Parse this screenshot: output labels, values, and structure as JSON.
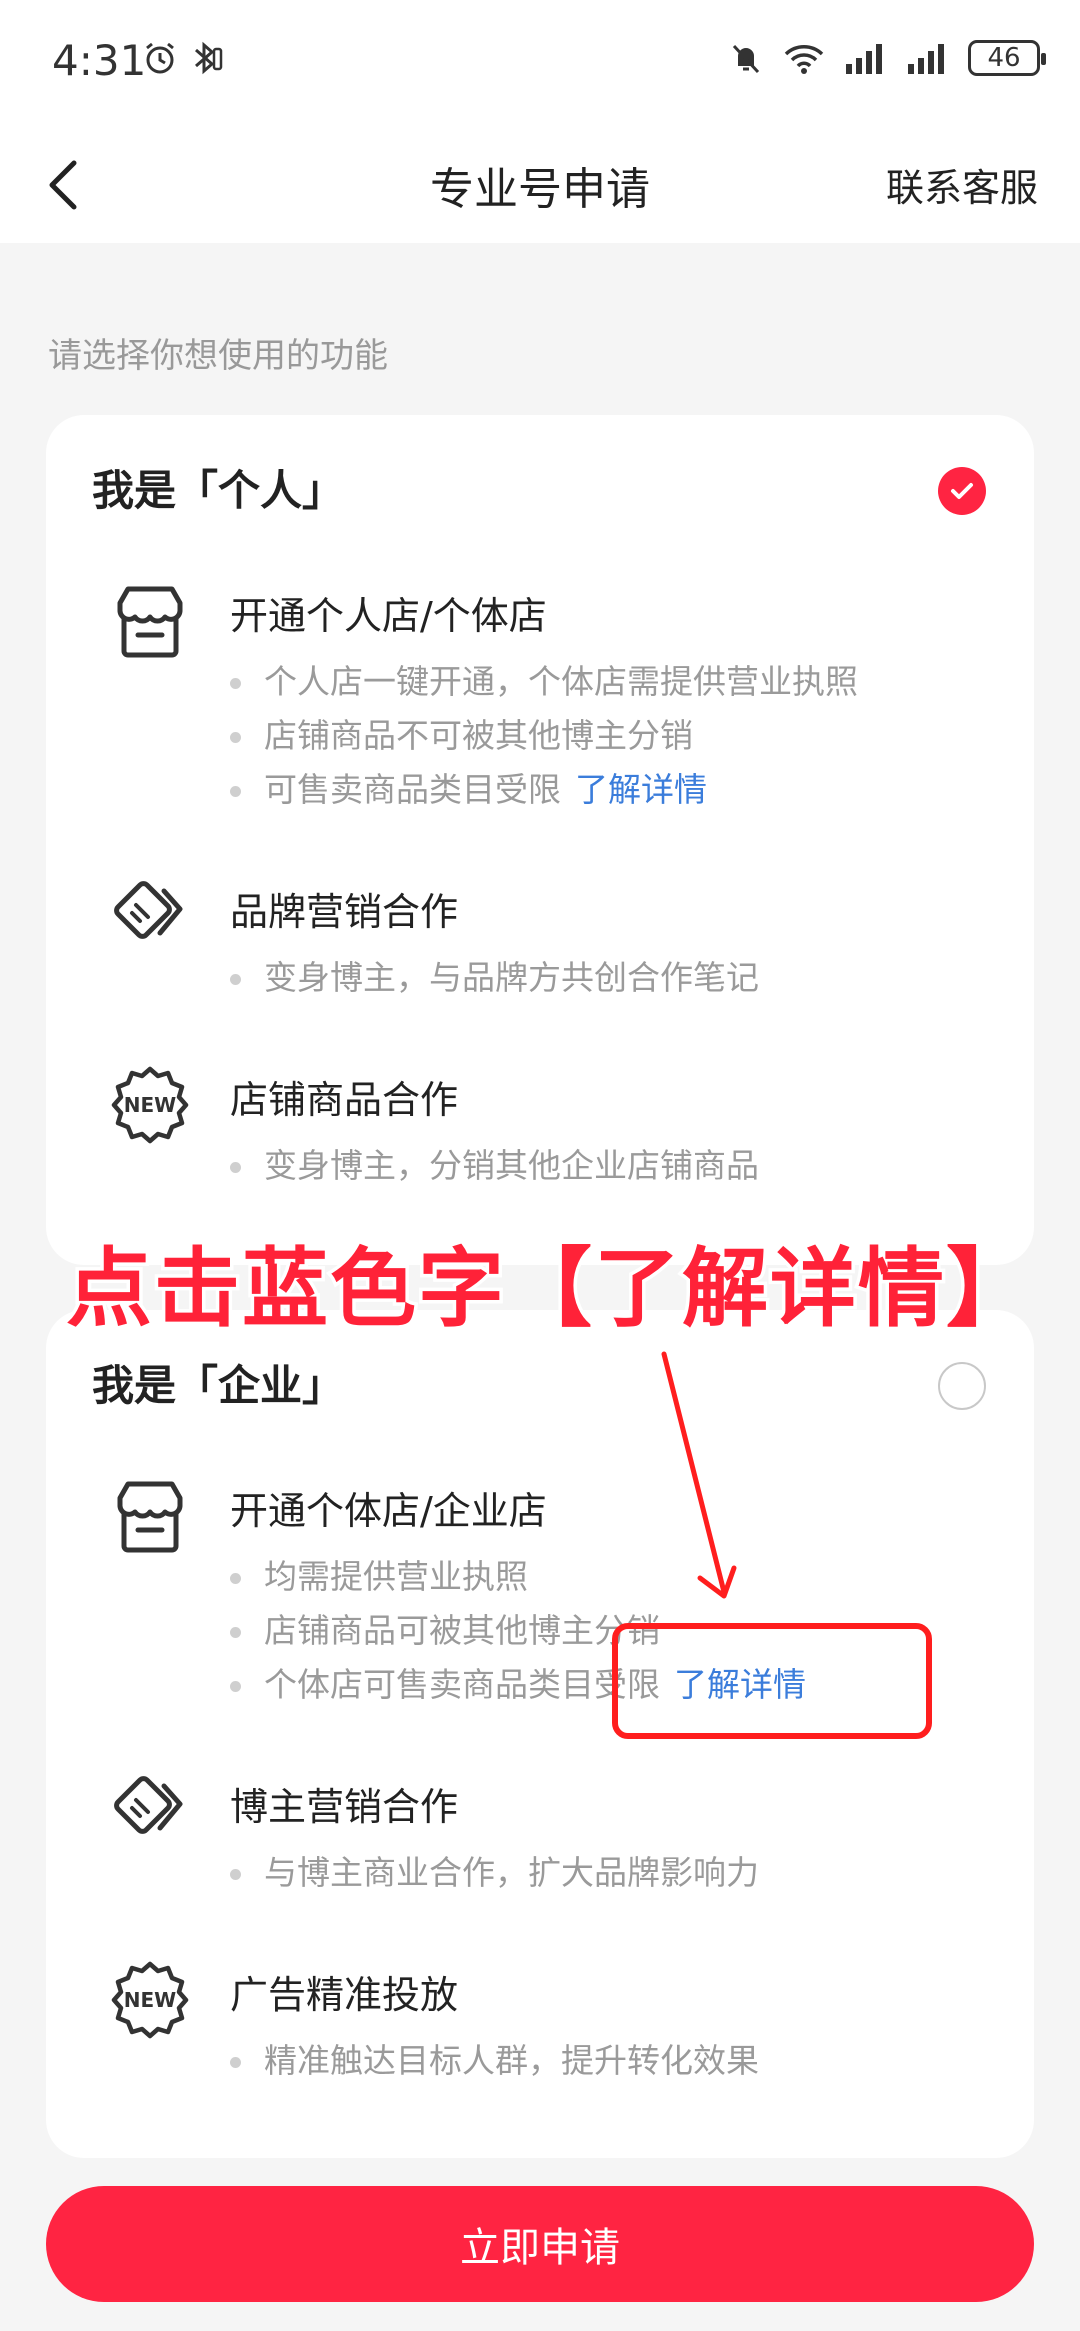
{
  "status_bar": {
    "time": "4:31",
    "battery": "46",
    "icons": [
      "alarm-icon",
      "bluetooth-icon",
      "mute-icon",
      "wifi-icon",
      "signal-icon",
      "signal-icon",
      "battery-icon"
    ]
  },
  "nav": {
    "title": "专业号申请",
    "right_label": "联系客服",
    "back_icon": "chevron-left-icon"
  },
  "hint": "请选择你想使用的功能",
  "personal": {
    "title": "我是「个人」",
    "selected": true,
    "features": [
      {
        "icon": "store-icon",
        "title": "开通个人店/个体店",
        "items": [
          "个人店一键开通，个体店需提供营业执照",
          "店铺商品不可被其他博主分销",
          "可售卖商品类目受限"
        ],
        "link": "了解详情"
      },
      {
        "icon": "tag-icon",
        "title": "品牌营销合作",
        "items": [
          "变身博主，与品牌方共创合作笔记"
        ]
      },
      {
        "icon": "new-badge-icon",
        "title": "店铺商品合作",
        "items": [
          "变身博主，分销其他企业店铺商品"
        ]
      }
    ]
  },
  "enterprise": {
    "title": "我是「企业」",
    "selected": false,
    "features": [
      {
        "icon": "store-icon",
        "title": "开通个体店/企业店",
        "items": [
          "均需提供营业执照",
          "店铺商品可被其他博主分销",
          "个体店可售卖商品类目受限"
        ],
        "link": "了解详情"
      },
      {
        "icon": "tag-icon",
        "title": "博主营销合作",
        "items": [
          "与博主商业合作，扩大品牌影响力"
        ]
      },
      {
        "icon": "new-badge-icon",
        "title": "广告精准投放",
        "items": [
          "精准触达目标人群，提升转化效果"
        ]
      }
    ]
  },
  "apply_button": "立即申请",
  "annotation": {
    "text": "点击蓝色字【了解详情】",
    "color": "#ff2238"
  },
  "colors": {
    "accent": "#ff2442",
    "link": "#3b7ddb"
  }
}
